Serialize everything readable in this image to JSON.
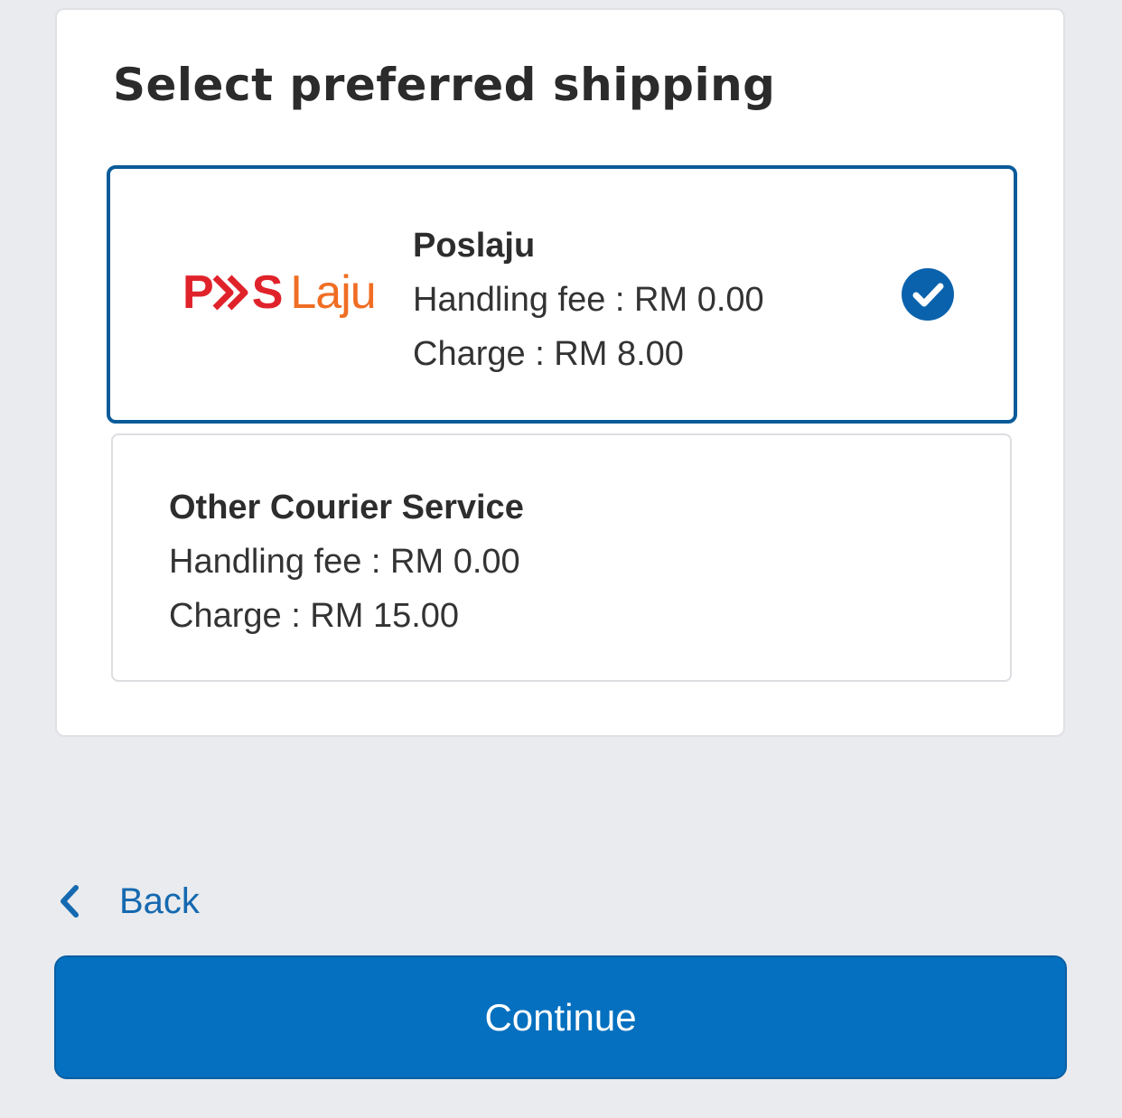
{
  "page": {
    "title": "Select preferred shipping"
  },
  "options": [
    {
      "name": "Poslaju",
      "logo": {
        "brand_pos": "POS",
        "brand_laju": "Laju",
        "colors": {
          "pos": "#e0232b",
          "laju": "#f06d23"
        }
      },
      "handling_fee": "Handling fee : RM 0.00",
      "charge": "Charge : RM 8.00",
      "selected": true,
      "selected_icon": "check-circle-icon"
    },
    {
      "name": "Other Courier Service",
      "handling_fee": "Handling fee : RM 0.00",
      "charge": "Charge : RM 15.00",
      "selected": false
    }
  ],
  "navigation": {
    "back_label": "Back",
    "back_icon": "chevron-left-icon",
    "continue_label": "Continue"
  },
  "colors": {
    "background": "#e9ebee",
    "accent": "#0470bf",
    "selected_border": "#0a5b99",
    "link": "#1569b0"
  }
}
